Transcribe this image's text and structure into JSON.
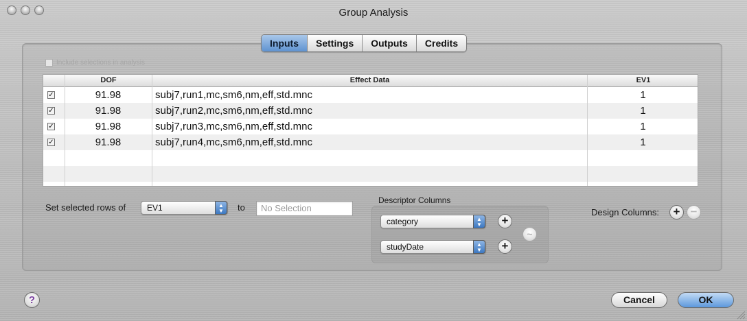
{
  "window": {
    "title": "Group Analysis"
  },
  "tabs": [
    {
      "label": "Inputs",
      "active": true
    },
    {
      "label": "Settings",
      "active": false
    },
    {
      "label": "Outputs",
      "active": false
    },
    {
      "label": "Credits",
      "active": false
    }
  ],
  "include_selections_label": "Include selections in analysis",
  "table": {
    "columns": [
      "DOF",
      "Effect Data",
      "EV1"
    ],
    "rows": [
      {
        "checked": true,
        "dof": "91.98",
        "effect": "subj7,run1,mc,sm6,nm,eff,std.mnc",
        "ev1": "1"
      },
      {
        "checked": true,
        "dof": "91.98",
        "effect": "subj7,run2,mc,sm6,nm,eff,std.mnc",
        "ev1": "1"
      },
      {
        "checked": true,
        "dof": "91.98",
        "effect": "subj7,run3,mc,sm6,nm,eff,std.mnc",
        "ev1": "1"
      },
      {
        "checked": true,
        "dof": "91.98",
        "effect": "subj7,run4,mc,sm6,nm,eff,std.mnc",
        "ev1": "1"
      }
    ]
  },
  "set_rows": {
    "label": "Set selected rows of",
    "column_value": "EV1",
    "to_label": "to",
    "value_placeholder": "No Selection"
  },
  "descriptor": {
    "title": "Descriptor Columns",
    "items": [
      "category",
      "studyDate"
    ]
  },
  "design_columns_label": "Design Columns:",
  "buttons": {
    "help": "?",
    "cancel": "Cancel",
    "ok": "OK",
    "add": "+",
    "remove": "−",
    "minus_tilde": "~"
  },
  "colors": {
    "accent": "#5d98dc",
    "tab_active": "#6c9bd3"
  }
}
